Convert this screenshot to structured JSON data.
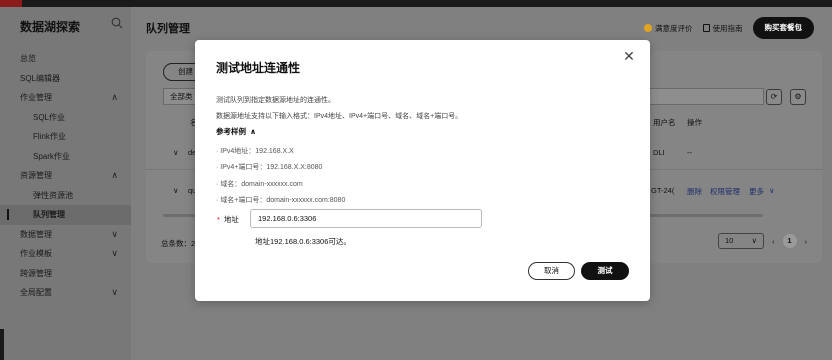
{
  "sidebar": {
    "brand": "数据湖探索",
    "items": [
      {
        "label": "总览",
        "level": 1,
        "chev": ""
      },
      {
        "label": "SQL编辑器",
        "level": 1,
        "chev": ""
      },
      {
        "label": "作业管理",
        "level": 1,
        "chev": "∧"
      },
      {
        "label": "SQL作业",
        "level": 2,
        "chev": ""
      },
      {
        "label": "Flink作业",
        "level": 2,
        "chev": ""
      },
      {
        "label": "Spark作业",
        "level": 2,
        "chev": ""
      },
      {
        "label": "资源管理",
        "level": 1,
        "chev": "∧"
      },
      {
        "label": "弹性资源池",
        "level": 2,
        "chev": ""
      },
      {
        "label": "队列管理",
        "level": 2,
        "chev": "",
        "active": true
      },
      {
        "label": "数据管理",
        "level": 1,
        "chev": "∨"
      },
      {
        "label": "作业模板",
        "level": 1,
        "chev": "∨"
      },
      {
        "label": "跨源管理",
        "level": 1,
        "chev": ""
      },
      {
        "label": "全局配置",
        "level": 1,
        "chev": "∨"
      }
    ]
  },
  "header": {
    "title": "队列管理",
    "satisfaction": "满意度评价",
    "guide": "使用指南",
    "buy": "购买套餐包"
  },
  "panel": {
    "create_label": "创建",
    "filter_label": "全部类",
    "col_name_partial": "名",
    "col_user": "用户名",
    "col_ops": "操作",
    "rows": [
      {
        "name_partial": "de",
        "user": "DLI",
        "ops": "--"
      },
      {
        "name_partial": "qu",
        "user": "GT-24(",
        "delete": "删除",
        "perm": "权限管理",
        "more": "更多"
      }
    ],
    "total": "总条数：2",
    "page_size": "10",
    "page": "1"
  },
  "modal": {
    "title": "测试地址连通性",
    "desc1": "测试队列到指定数据源地址的连通性。",
    "desc2": "数据源地址支持以下输入格式：IPv4地址、IPv4+端口号、域名、域名+端口号。",
    "examples_head": "参考样例",
    "examples": [
      "· IPv4地址：192.168.X.X",
      "· IPv4+端口号：192.168.X.X:8080",
      "· 域名：domain-xxxxxx.com",
      "· 域名+端口号：domain-xxxxxx.com:8080"
    ],
    "addr_label": "地址",
    "addr_value": "192.168.0.6:3306",
    "result": "地址192.168.0.6:3306可达。",
    "cancel": "取消",
    "test": "测试"
  }
}
